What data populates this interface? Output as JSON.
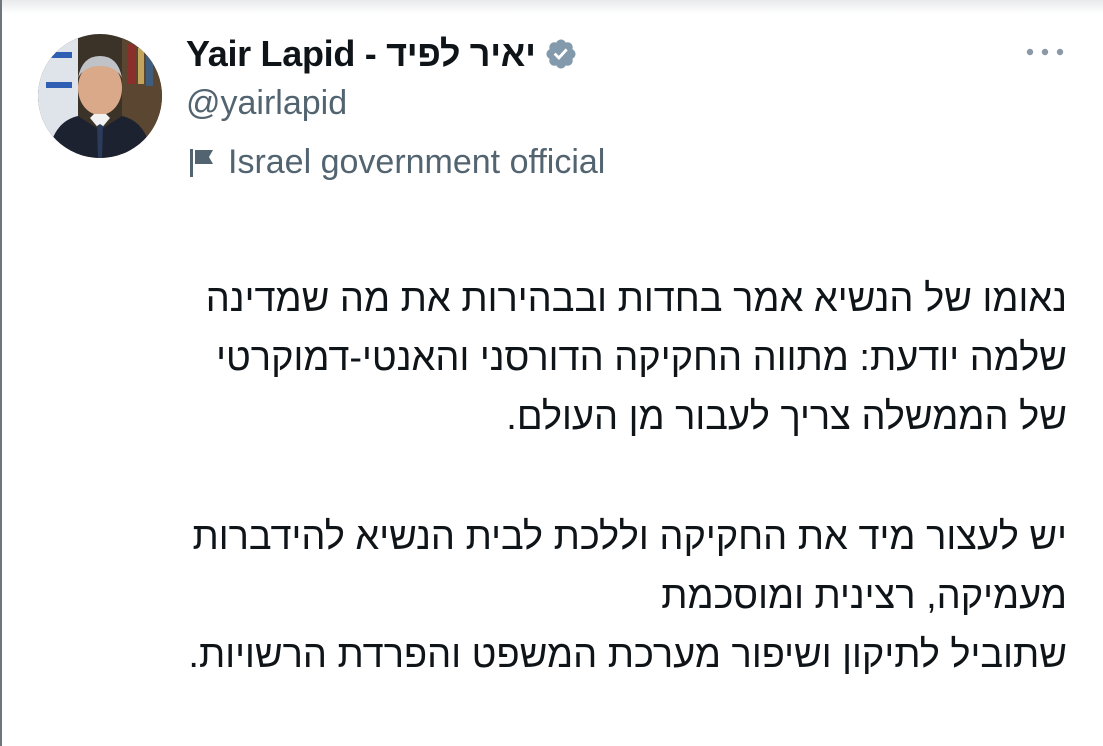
{
  "author": {
    "display_name": "Yair Lapid - יאיר לפיד",
    "handle": "@yairlapid",
    "affiliation": "Israel government official",
    "verified_badge_color": "#829aab"
  },
  "icons": {
    "verified": "verified-badge-icon",
    "affiliation": "flag-icon",
    "more": "more-options-icon"
  },
  "tweet": {
    "paragraphs": [
      {
        "lines": [
          "נאומו של הנשיא אמר בחדות ובבהירות את מה שמדינה",
          "שלמה יודעת: מתווה החקיקה הדורסני והאנטי-דמוקרטי",
          "של הממשלה צריך לעבור מן העולם."
        ]
      },
      {
        "lines": [
          "יש לעצור מיד את החקיקה וללכת לבית הנשיא להידברות",
          "מעמיקה, רצינית ומוסכמת",
          "שתוביל לתיקון ושיפור מערכת המשפט והפרדת הרשויות."
        ]
      }
    ]
  }
}
